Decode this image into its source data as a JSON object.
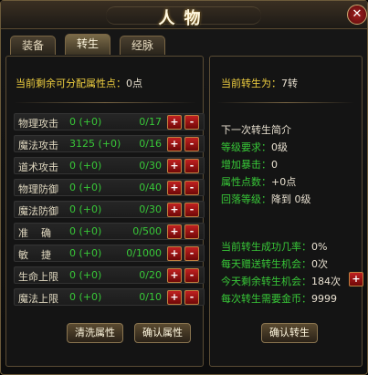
{
  "window": {
    "title": "人物"
  },
  "tabs": [
    {
      "label": "装备"
    },
    {
      "label": "转生"
    },
    {
      "label": "经脉"
    }
  ],
  "left": {
    "points_label": "当前剩余可分配属性点：",
    "points_value": "0点",
    "rows": [
      {
        "label": "物理攻击",
        "value": "0 (+0)",
        "max": "0/17"
      },
      {
        "label": "魔法攻击",
        "value": "3125 (+0)",
        "max": "0/16"
      },
      {
        "label": "道术攻击",
        "value": "0 (+0)",
        "max": "0/30"
      },
      {
        "label": "物理防御",
        "value": "0 (+0)",
        "max": "0/40"
      },
      {
        "label": "魔法防御",
        "value": "0 (+0)",
        "max": "0/30"
      },
      {
        "label": "准    确",
        "value": "0 (+0)",
        "max": "0/500"
      },
      {
        "label": "敏    捷",
        "value": "0 (+0)",
        "max": "0/1000"
      },
      {
        "label": "生命上限",
        "value": "0 (+0)",
        "max": "0/20"
      },
      {
        "label": "魔法上限",
        "value": "0 (+0)",
        "max": "0/10"
      }
    ],
    "plus": "+",
    "minus": "-",
    "reset_button": "清洗属性",
    "confirm_button": "确认属性"
  },
  "right": {
    "rebirth_label": "当前转生为：",
    "rebirth_value": "7转",
    "next_title": "下一次转生简介",
    "level_label": "等级要求：",
    "level_value": "0级",
    "crit_label": "增加暴击：",
    "crit_value": "0",
    "attr_label": "属性点数：",
    "attr_value": "+0点",
    "drop_label": "回落等级：",
    "drop_value": "降到 0级",
    "success_label": "当前转生成功几率：",
    "success_value": "0%",
    "gift_label": "每天赠送转生机会：",
    "gift_value": "0次",
    "remain_label": "今天剩余转生机会：",
    "remain_value": "184次",
    "gold_label": "每次转生需要金币：",
    "gold_value": "9999",
    "plus": "+",
    "confirm_button": "确认转生"
  }
}
